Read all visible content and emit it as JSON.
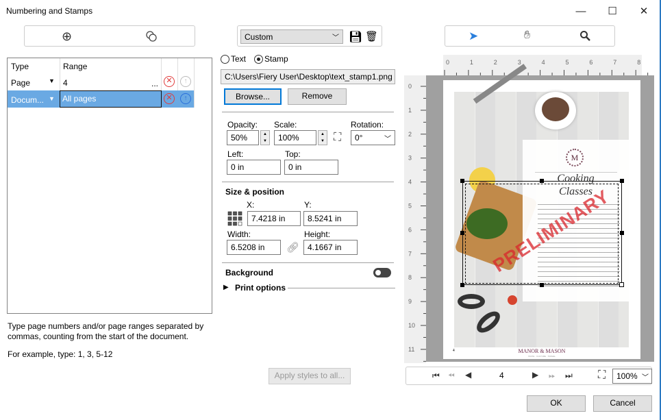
{
  "window": {
    "title": "Numbering and Stamps",
    "controls": [
      "minimize",
      "maximize",
      "close"
    ]
  },
  "left": {
    "toolbar": {
      "add_icon": "plus-circle-icon",
      "duplicate_icon": "overlap-circles-icon"
    },
    "table": {
      "headers": [
        "Type",
        "Range"
      ],
      "rows": [
        {
          "type": "Page",
          "range": "4",
          "more": "...",
          "selected": false,
          "up_enabled": false
        },
        {
          "type": "Docum...",
          "range": "All pages",
          "selected": true,
          "up_enabled": true
        }
      ]
    },
    "help_text": "Type page numbers and/or page ranges separated by commas, counting from the start of the document.",
    "example_text": "For example, type: 1, 3, 5-12"
  },
  "middle": {
    "preset": "Custom",
    "mode_options": [
      "Text",
      "Stamp"
    ],
    "mode_selected": "Stamp",
    "file_path": "C:\\Users\\Fiery User\\Desktop\\text_stamp1.png",
    "browse_label": "Browse...",
    "remove_label": "Remove",
    "opacity_label": "Opacity:",
    "opacity": "50%",
    "scale_label": "Scale:",
    "scale": "100%",
    "rotation_label": "Rotation:",
    "rotation": "0°",
    "left_label": "Left:",
    "left": "0 in",
    "top_label": "Top:",
    "top": "0 in",
    "size_heading": "Size & position",
    "x_label": "X:",
    "x": "7.4218 in",
    "y_label": "Y:",
    "y": "8.5241 in",
    "width_label": "Width:",
    "width": "6.5208 in",
    "height_label": "Height:",
    "height": "4.1667 in",
    "background_label": "Background",
    "background_on": false,
    "print_options_label": "Print options",
    "apply_label": "Apply styles to all..."
  },
  "preview": {
    "tools": [
      "pointer",
      "hand",
      "zoom"
    ],
    "active_tool": "pointer",
    "ruler_h": [
      "0",
      "1",
      "2",
      "3",
      "4",
      "5",
      "6",
      "7",
      "8"
    ],
    "ruler_v": [
      "0",
      "1",
      "2",
      "3",
      "4",
      "5",
      "6",
      "7",
      "8",
      "9",
      "10",
      "11"
    ],
    "page": {
      "title_line1": "Cooking",
      "title_line2": "Classes",
      "monogram": "M",
      "stamp_text": "PRELIMINARY",
      "brand": "MANOR & MASON",
      "tagline": "TASTE · CULTURE · TRAVEL",
      "page_number": "4",
      "stamp_color": "#d9262c"
    },
    "nav": {
      "page": "4",
      "zoom": "100%"
    }
  },
  "footer": {
    "ok_label": "OK",
    "cancel_label": "Cancel"
  },
  "colors": {
    "selection": "#6aa9e3",
    "accent": "#0078d7",
    "delete": "#e03a3a",
    "up": "#2a6fdb"
  }
}
